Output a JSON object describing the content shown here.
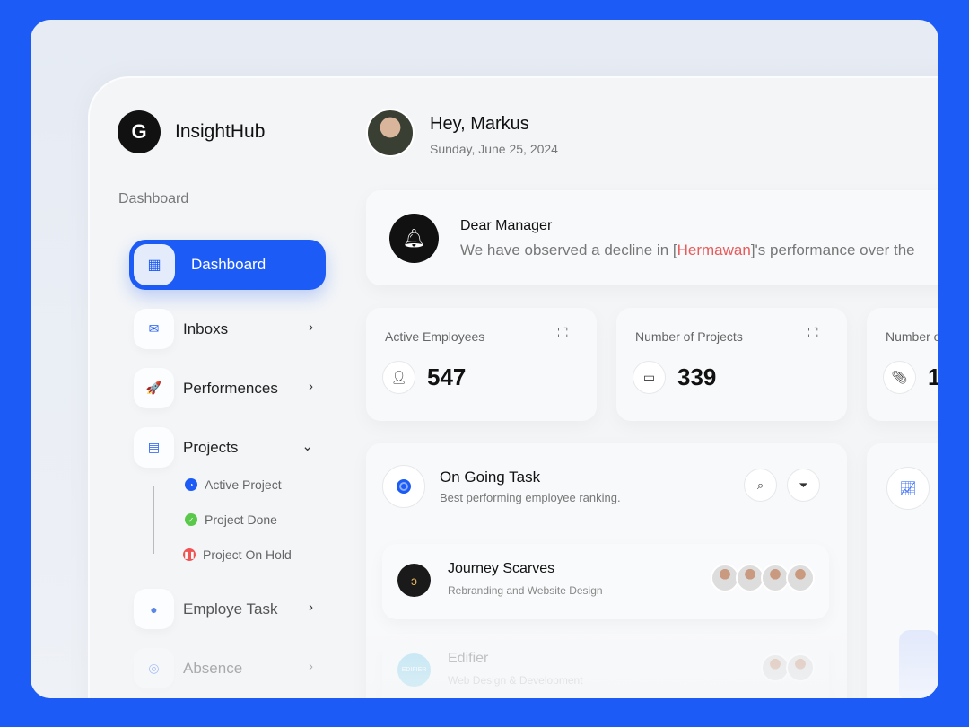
{
  "brand": {
    "name": "InsightHub",
    "logo_letter": "G"
  },
  "sidebar": {
    "section": "Dashboard",
    "active": "Dashboard",
    "items": [
      {
        "label": "Inboxs",
        "icon": "mail-icon"
      },
      {
        "label": "Performences",
        "icon": "rocket-icon"
      },
      {
        "label": "Projects",
        "icon": "project-icon"
      },
      {
        "label": "Employe Task",
        "icon": "user-icon"
      },
      {
        "label": "Absence",
        "icon": "fingerprint-icon"
      }
    ],
    "sub_items": [
      {
        "label": "Active Project",
        "color": "#1d5bf6"
      },
      {
        "label": "Project Done",
        "color": "#5ac84a"
      },
      {
        "label": "Project On Hold",
        "color": "#ef5353"
      }
    ]
  },
  "header": {
    "greeting": "Hey, Markus",
    "date": "Sunday, June 25, 2024"
  },
  "notice": {
    "title": "Dear Manager",
    "msg_pre": "We have observed a decline in [",
    "name": "Hermawan",
    "msg_post": "]'s performance over the"
  },
  "stats": [
    {
      "title": "Active Employees",
      "value": "547",
      "icon": "user-icon"
    },
    {
      "title": "Number of Projects",
      "value": "339",
      "icon": "folder-icon"
    },
    {
      "title": "Number o",
      "value": "1",
      "icon": "paperclip-icon"
    }
  ],
  "task": {
    "title": "On Going Task",
    "subtitle": "Best performing employee ranking.",
    "projects": [
      {
        "name": "Journey Scarves",
        "desc": "Rebranding and Website Design",
        "logo": "ↄ"
      },
      {
        "name": "Edifier",
        "desc": "Web Design & Development",
        "logo": "EDIFIER"
      }
    ]
  },
  "colors": {
    "accent": "#1d5bf6",
    "alert": "#e85b5b"
  }
}
